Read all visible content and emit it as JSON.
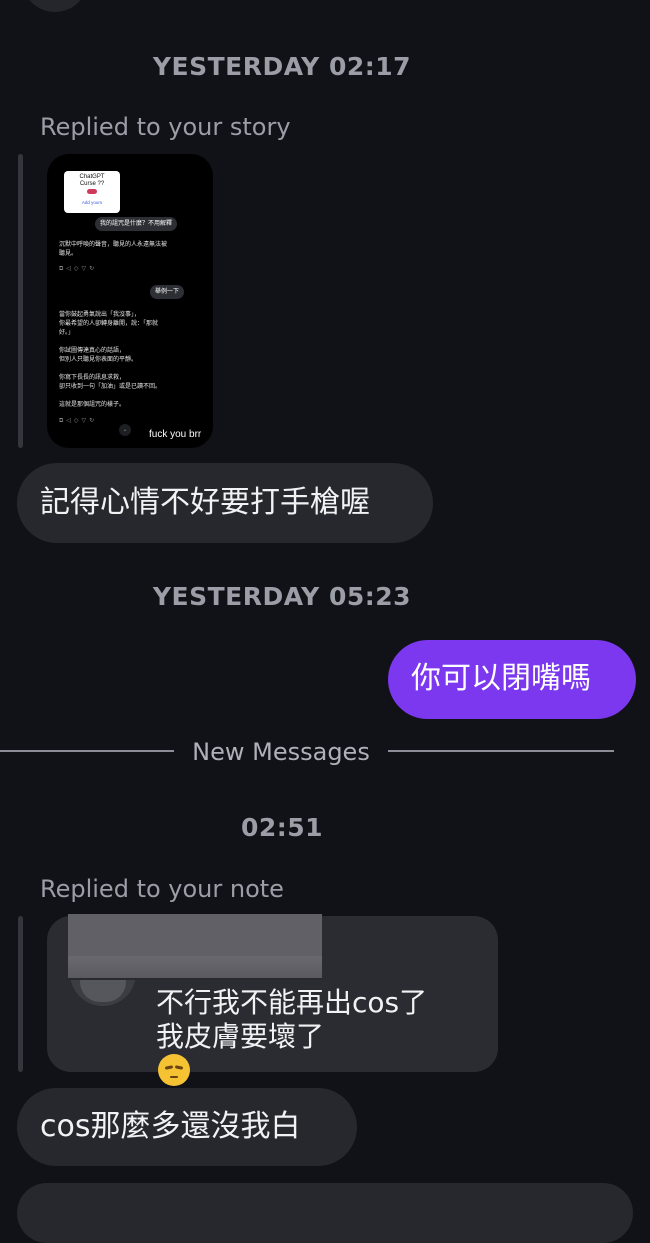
{
  "conversation": {
    "timestamp_1": "YESTERDAY 02:17",
    "story_reply": {
      "label": "Replied to your story",
      "thumbnail": {
        "card_title": "ChatGPT\nCurse ??",
        "card_action": "Add yours",
        "question_1": "我的詛咒是什麼？不用解釋",
        "answer_1": "沉默中呼喚的聲音，聽見的人永遠無法被\n聽見。",
        "question_2": "舉例一下",
        "answer_2": "當你鼓起勇氣說出「我沒事」，\n你最希望的人卻轉身離開，說：「那就\n好。」\n\n你試圖傳達真心的話語，\n但別人只聽見你表面的平靜。\n\n你寫下長長的訊息求救，\n卻只收到一句「加油」或是已讀不回。\n\n這就是那個詛咒的樣子。",
        "caption": "fuck you brr"
      }
    },
    "incoming_1": "記得心情不好要打手槍喔",
    "timestamp_2": "YESTERDAY 05:23",
    "outgoing_1": "你可以閉嘴嗎",
    "new_messages_label": "New Messages",
    "timestamp_3": "02:51",
    "note_reply": {
      "label": "Replied to your note",
      "note_line_1": "不行我不能再出cos了",
      "note_line_2": "我皮膚要壞了",
      "note_emoji": "pensive-face"
    },
    "incoming_2": "cos那麼多還沒我白"
  },
  "colors": {
    "background": "#101217",
    "incoming_bubble": "#26282e",
    "outgoing_bubble": "#7b38ef",
    "timestamp_text": "#9b9ea7"
  }
}
